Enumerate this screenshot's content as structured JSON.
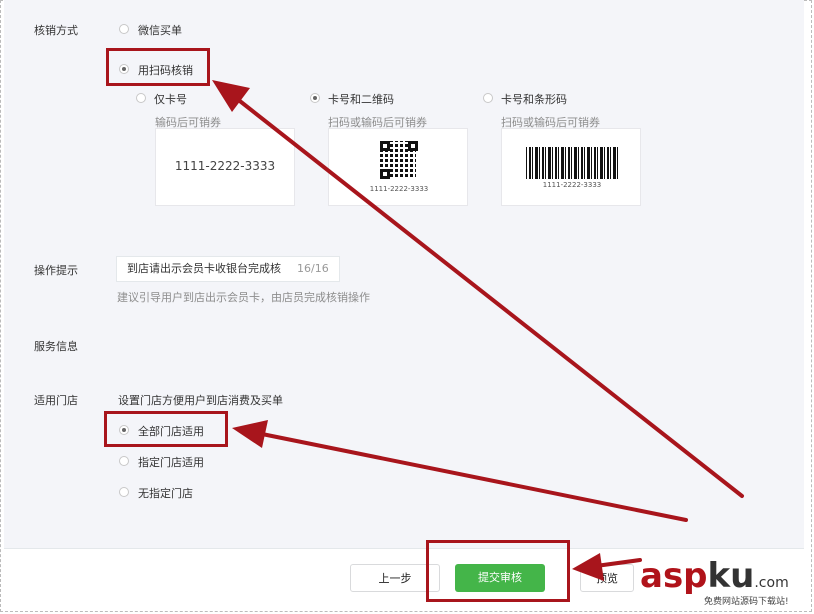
{
  "verify_method": {
    "label": "核销方式",
    "options": [
      {
        "label": "微信买单",
        "selected": false
      },
      {
        "label": "用扫码核销",
        "selected": true
      }
    ],
    "code_types": [
      {
        "label": "仅卡号",
        "hint": "输码后可销券",
        "selected": false,
        "preview_text": "1111-2222-3333"
      },
      {
        "label": "卡号和二维码",
        "hint": "扫码或输码后可销券",
        "selected": true,
        "preview_text": "1111-2222-3333"
      },
      {
        "label": "卡号和条形码",
        "hint": "扫码或输码后可销券",
        "selected": false,
        "preview_text": "1111-2222-3333"
      }
    ]
  },
  "operation_tip": {
    "label": "操作提示",
    "value": "到店请出示会员卡收银台完成核",
    "counter": "16/16",
    "help": "建议引导用户到店出示会员卡，由店员完成核销操作"
  },
  "service_info": {
    "label": "服务信息"
  },
  "stores": {
    "label": "适用门店",
    "description": "设置门店方便用户到店消费及买单",
    "options": [
      {
        "label": "全部门店适用",
        "selected": true
      },
      {
        "label": "指定门店适用",
        "selected": false
      },
      {
        "label": "无指定门店",
        "selected": false
      }
    ]
  },
  "footer": {
    "prev_label": "上一步",
    "submit_label": "提交审核",
    "preview_label": "预览"
  },
  "watermark": {
    "brand_a": "asp",
    "brand_b": "ku",
    "brand_c": ".com",
    "tagline": "免费网站源码下载站!"
  },
  "colors": {
    "annotation_red": "#a8151c",
    "submit_green": "#44b549",
    "panel_bg": "#f4f5f9"
  }
}
